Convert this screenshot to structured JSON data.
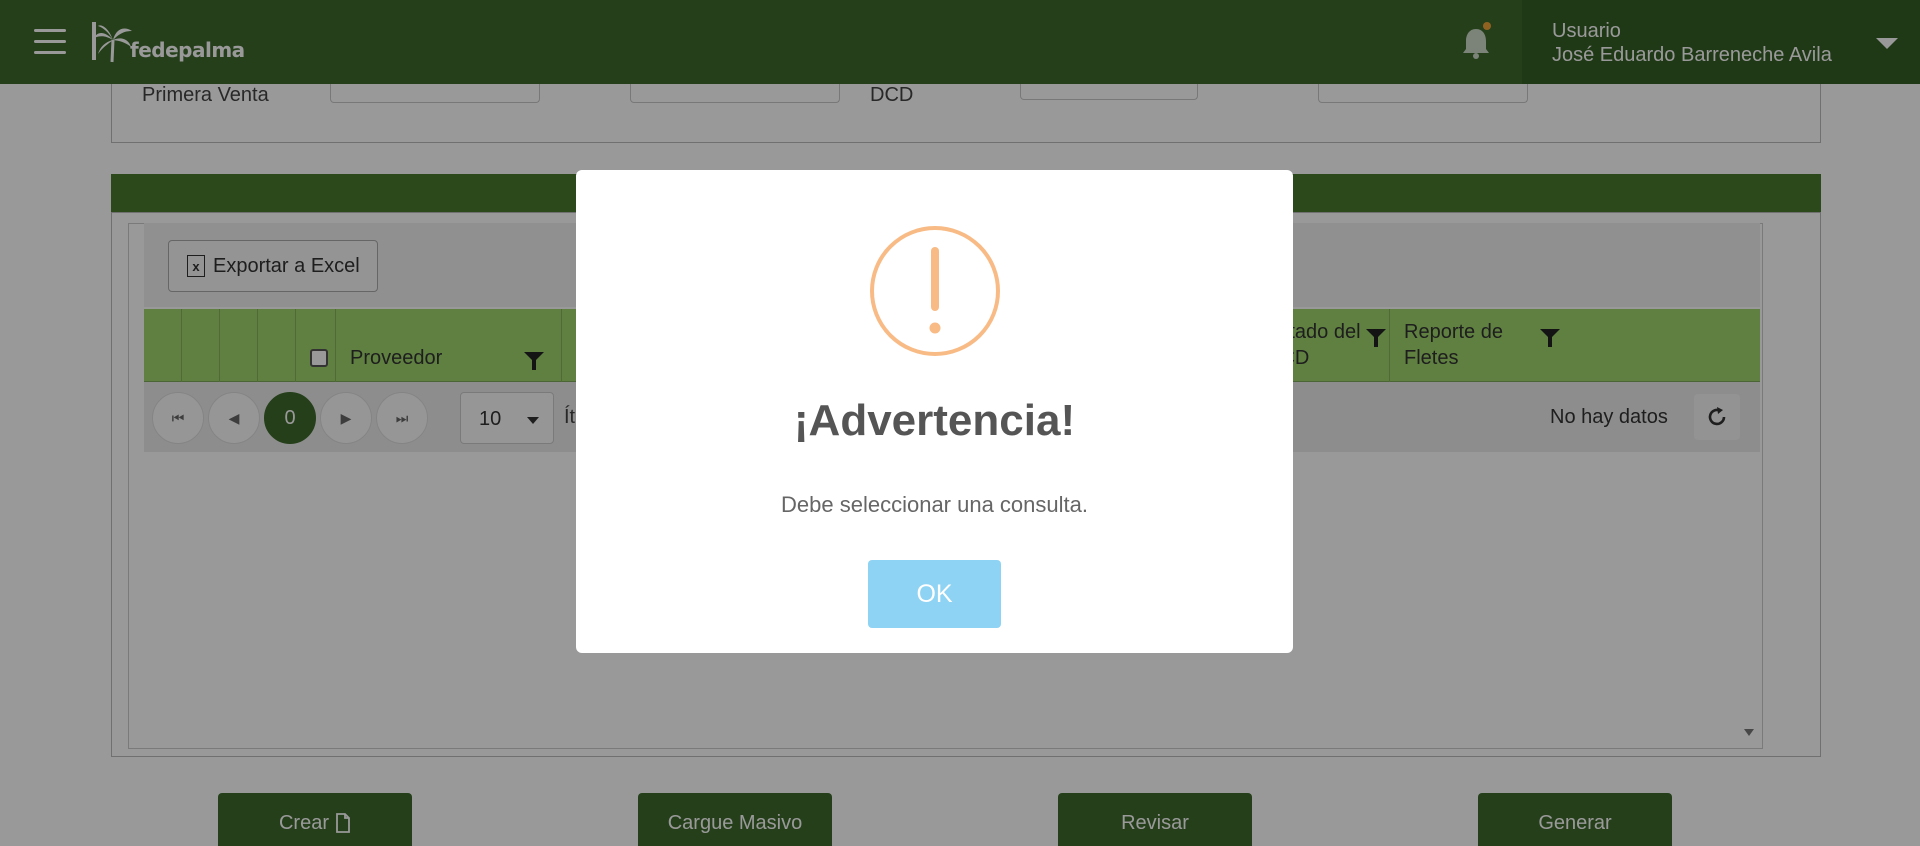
{
  "header": {
    "logo_text": "fedepalma",
    "user_role": "Usuario",
    "user_name": "José Eduardo Barreneche Avila"
  },
  "filters": {
    "label_primera_venta": "Primera Venta",
    "label_dcd": "DCD"
  },
  "grid": {
    "export_button": "Exportar a Excel",
    "columns": {
      "proveedor": "Proveedor",
      "estado_dcd": "Estado del DCD",
      "reporte_fletes": "Reporte de Fletes"
    },
    "pager": {
      "current_page": "0",
      "page_size": "10",
      "items_label": "Ít",
      "no_data": "No hay datos"
    }
  },
  "actions": {
    "crear": "Crear",
    "cargue_masivo": "Cargue Masivo",
    "revisar": "Revisar",
    "generar": "Generar"
  },
  "modal": {
    "title": "¡Advertencia!",
    "message": "Debe seleccionar una consulta.",
    "ok_label": "OK"
  },
  "colors": {
    "brand_green": "#3d6a2b",
    "header_green": "#9ed56b",
    "warning_orange": "#f8bb86",
    "ok_blue": "#8fd3f4"
  },
  "icons": [
    "menu-icon",
    "palm-logo-icon",
    "bell-icon",
    "caret-down-icon",
    "excel-icon",
    "filter-icon",
    "refresh-icon",
    "file-icon",
    "warning-icon"
  ]
}
